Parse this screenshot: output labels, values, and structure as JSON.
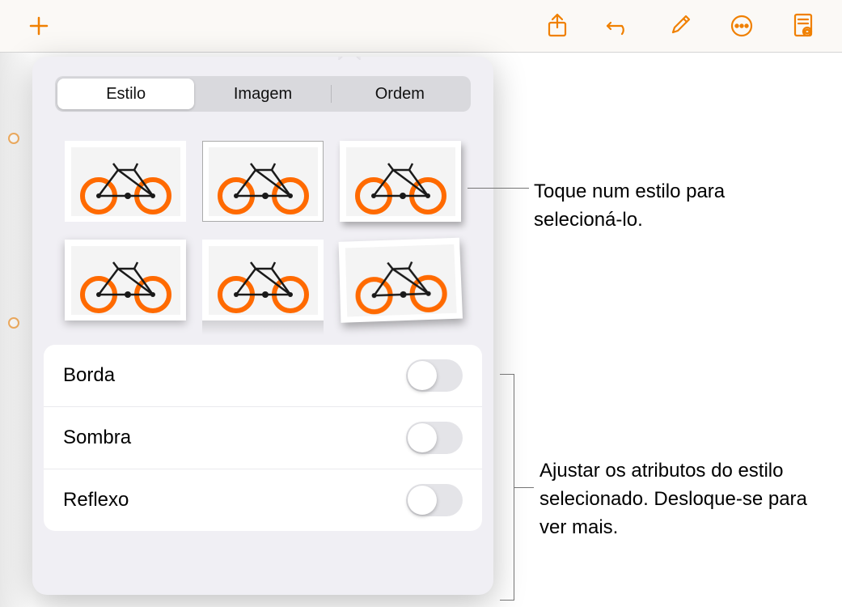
{
  "toolbar": {
    "icons": [
      "plus-icon",
      "share-icon",
      "undo-icon",
      "brush-icon",
      "more-icon",
      "document-icon"
    ]
  },
  "tabs": {
    "style": "Estilo",
    "image": "Imagem",
    "order": "Ordem",
    "active": "style"
  },
  "controls": {
    "border": {
      "label": "Borda",
      "on": false
    },
    "shadow": {
      "label": "Sombra",
      "on": false
    },
    "reflection": {
      "label": "Reflexo",
      "on": false
    }
  },
  "callouts": {
    "tap_style": "Toque num estilo para selecioná-lo.",
    "adjust": "Ajustar os atributos do estilo selecionado. Desloque-se para ver mais."
  },
  "colors": {
    "accent": "#f08000"
  }
}
